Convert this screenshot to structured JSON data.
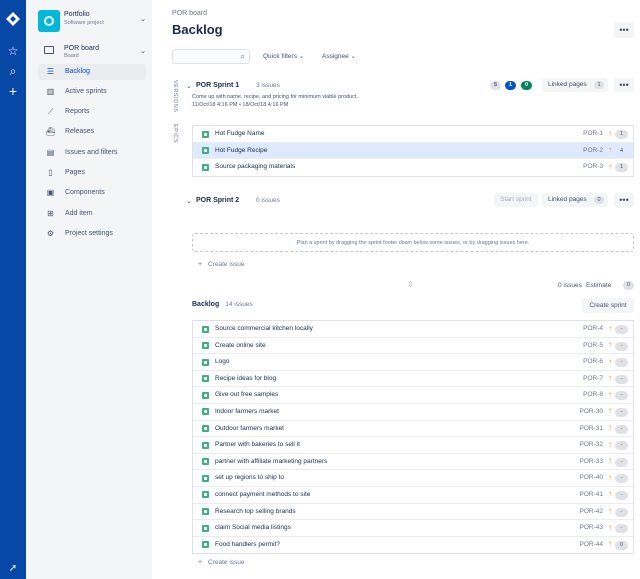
{
  "global_nav": {
    "icons": [
      "jira-logo-icon",
      "star-icon",
      "search-icon",
      "plus-icon",
      "rocket-icon"
    ]
  },
  "project": {
    "name": "Portfolio",
    "type": "Software project"
  },
  "board": {
    "name": "POR board",
    "sub": "Board"
  },
  "sidebar": {
    "items": [
      {
        "label": "Backlog",
        "icon": "backlog-icon",
        "active": true
      },
      {
        "label": "Active sprints",
        "icon": "board-icon"
      },
      {
        "label": "Reports",
        "icon": "chart-icon"
      },
      {
        "label": "Releases",
        "icon": "ship-icon"
      },
      {
        "label": "Issues and filters",
        "icon": "issues-icon"
      },
      {
        "label": "Pages",
        "icon": "page-icon"
      },
      {
        "label": "Components",
        "icon": "component-icon"
      },
      {
        "label": "Add item",
        "icon": "add-item-icon"
      },
      {
        "label": "Project settings",
        "icon": "gear-icon"
      }
    ]
  },
  "header": {
    "breadcrumb": "POR board",
    "title": "Backlog",
    "more": "•••"
  },
  "toolbar": {
    "search_placeholder": "",
    "quick_filters": "Quick filters",
    "assignee": "Assignee"
  },
  "side_tabs": {
    "versions": "VERSIONS",
    "epics": "EPICS"
  },
  "sprint1": {
    "name": "POR Sprint 1",
    "count": "3 issues",
    "description": "Come up with name, recipe, and pricing for minimum viable product.",
    "dates": "11/Oct/18 4:16 PM  •  18/Oct/18 4:16 PM",
    "status_counts": {
      "todo": "5",
      "in_progress": "1",
      "done": "0"
    },
    "status_colors": {
      "todo": "#dfe1e6",
      "in_progress": "#0052cc",
      "done": "#00875a"
    },
    "linked_pages": "Linked pages",
    "linked_count": "1",
    "more": "•••",
    "issues": [
      {
        "summary": "Hot Fudge Name",
        "key": "POR-1",
        "estimate": "1",
        "selected": false
      },
      {
        "summary": "Hot Fudge Recipe",
        "key": "POR-2",
        "estimate": "4",
        "selected": true
      },
      {
        "summary": "Source packaging materials",
        "key": "POR-3",
        "estimate": "1",
        "selected": false
      }
    ]
  },
  "sprint2": {
    "name": "POR Sprint 2",
    "count": "0 issues",
    "start_sprint": "Start sprint",
    "linked_pages": "Linked pages",
    "linked_count": "0",
    "more": "•••",
    "drop_hint": "Plan a sprint by dragging the sprint footer down below some issues, or by dragging issues here.",
    "create_issue": "Create issue",
    "issues_count": "0 issues",
    "estimate_label": "Estimate",
    "estimate_value": "0"
  },
  "backlog": {
    "title": "Backlog",
    "count": "14 issues",
    "create_sprint": "Create sprint",
    "create_issue": "Create issue",
    "issues": [
      {
        "summary": "Source commercial kitchen locally",
        "key": "POR-4",
        "estimate": "-"
      },
      {
        "summary": "Create online site",
        "key": "POR-5",
        "estimate": "-"
      },
      {
        "summary": "Logo",
        "key": "POR-6",
        "estimate": "-"
      },
      {
        "summary": "Recipe ideas for blog",
        "key": "POR-7",
        "estimate": "-"
      },
      {
        "summary": "Give out free samples",
        "key": "POR-8",
        "estimate": "-"
      },
      {
        "summary": "Indoor farmers market",
        "key": "POR-30",
        "estimate": "-"
      },
      {
        "summary": "Outdoor farmers market",
        "key": "POR-31",
        "estimate": "-"
      },
      {
        "summary": "Partner with bakeries to sell it",
        "key": "POR-32",
        "estimate": "-"
      },
      {
        "summary": "partner with affiliate marketing partners",
        "key": "POR-33",
        "estimate": "-"
      },
      {
        "summary": "set up regions to ship to",
        "key": "POR-40",
        "estimate": "-"
      },
      {
        "summary": "connect payment methods to site",
        "key": "POR-41",
        "estimate": "-"
      },
      {
        "summary": "Research top selling brands",
        "key": "POR-42",
        "estimate": "-"
      },
      {
        "summary": "claim Social media listings",
        "key": "POR-43",
        "estimate": "-"
      },
      {
        "summary": "Food handlers permit?",
        "key": "POR-44",
        "estimate": "0"
      }
    ]
  },
  "colors": {
    "nav": "#0747a6",
    "story": "#36b37e",
    "priority": "#ff8b00",
    "selected_row": "#deebff"
  }
}
